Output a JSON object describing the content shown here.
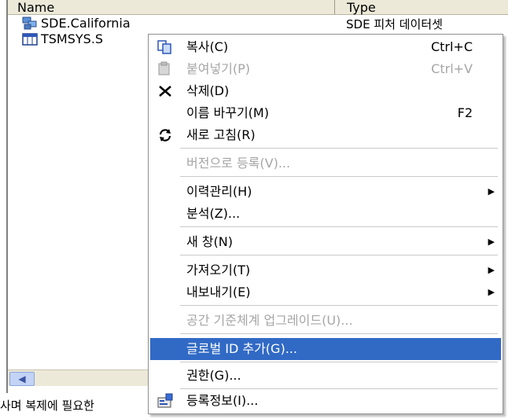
{
  "list": {
    "columns": {
      "name": "Name",
      "type": "Type"
    },
    "rows": [
      {
        "name": "SDE.California",
        "type": "SDE 피처 데이터셋",
        "icon": "feature-dataset-icon"
      },
      {
        "name": "TSMSYS.S",
        "icon": "table-icon"
      }
    ]
  },
  "status_text": "사며 복제에 필요한",
  "menu": {
    "items": [
      {
        "label": "복사(C)",
        "shortcut": "Ctrl+C",
        "icon": "copy-icon",
        "disabled": false
      },
      {
        "label": "붙여넣기(P)",
        "shortcut": "Ctrl+V",
        "icon": "paste-icon",
        "disabled": true
      },
      {
        "label": "삭제(D)",
        "icon": "delete-x-icon",
        "disabled": false
      },
      {
        "label": "이름 바꾸기(M)",
        "shortcut": "F2",
        "disabled": false
      },
      {
        "label": "새로 고침(R)",
        "icon": "refresh-icon",
        "disabled": false
      },
      {
        "label": "버전으로 등록(V)...",
        "disabled": true
      },
      {
        "label": "이력관리(H)",
        "submenu": true
      },
      {
        "label": "분석(Z)..."
      },
      {
        "label": "새 창(N)",
        "submenu": true
      },
      {
        "label": "가져오기(T)",
        "submenu": true
      },
      {
        "label": "내보내기(E)",
        "submenu": true
      },
      {
        "label": "공간 기준체계 업그레이드(U)...",
        "disabled": true
      },
      {
        "label": "글로벌 ID 추가(G)...",
        "selected": true
      },
      {
        "label": "권한(G)..."
      },
      {
        "label": "등록정보(I)...",
        "icon": "properties-icon"
      }
    ]
  },
  "colors": {
    "selection": "#316ac5",
    "disabled_text": "#a6a6a6",
    "header_bg": "#ece9d8"
  }
}
